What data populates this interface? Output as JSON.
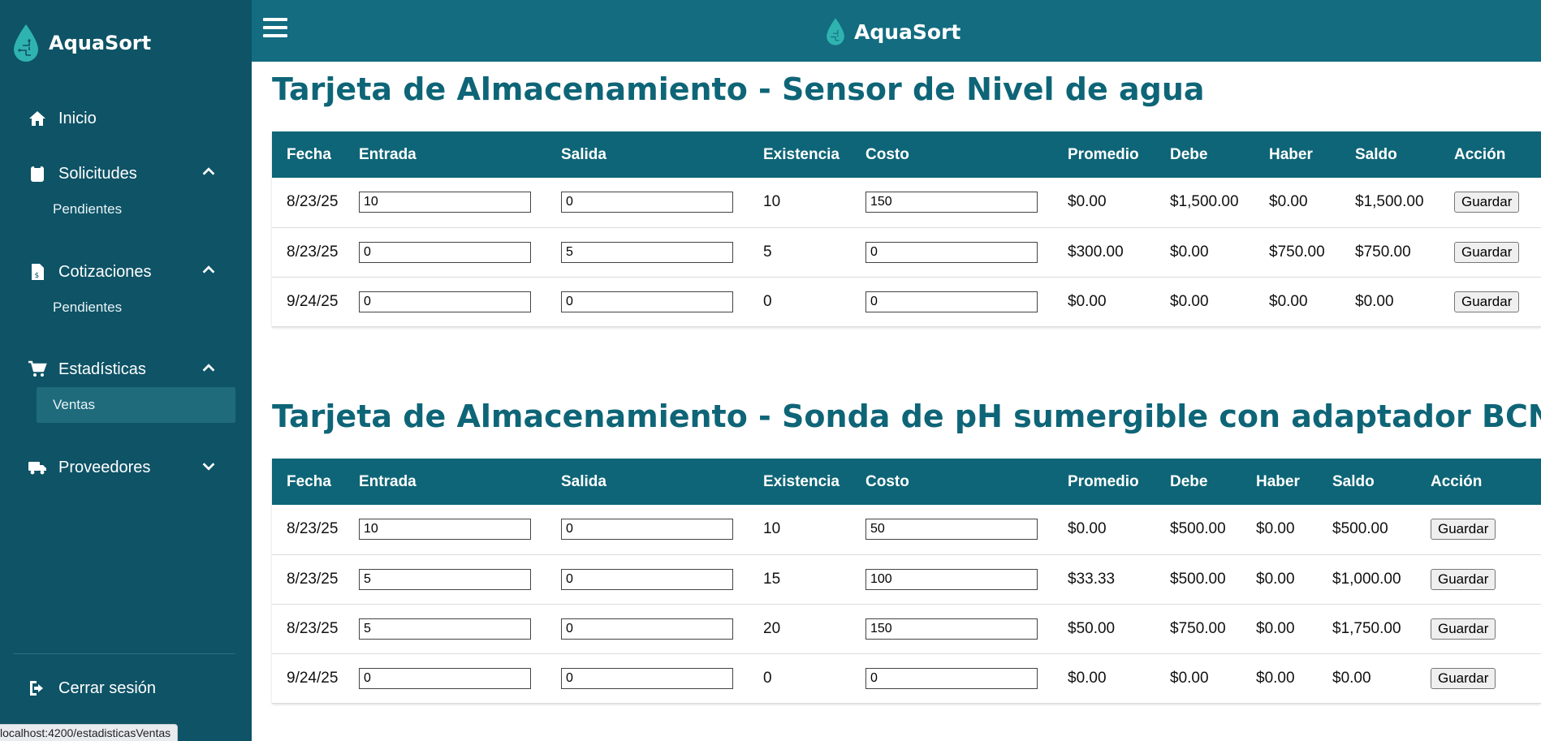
{
  "app": {
    "name": "AquaSort"
  },
  "sidebar": {
    "items": [
      {
        "label": "Inicio",
        "icon": "home-icon"
      },
      {
        "label": "Solicitudes",
        "icon": "clipboard-icon",
        "sub": "Pendientes"
      },
      {
        "label": "Cotizaciones",
        "icon": "invoice-icon",
        "sub": "Pendientes"
      },
      {
        "label": "Estadísticas",
        "icon": "cart-icon",
        "sub": "Ventas"
      },
      {
        "label": "Proveedores",
        "icon": "truck-icon"
      }
    ],
    "logout": "Cerrar sesión"
  },
  "status_url": "localhost:4200/estadisticasVentas",
  "colors": {
    "sidebar": "#0e5366",
    "topbar": "#136c80",
    "table_header": "#0e6577",
    "title": "#0e6577"
  },
  "cards": [
    {
      "title": "Tarjeta de Almacenamiento - Sensor de Nivel de agua",
      "headers": [
        "Fecha",
        "Entrada",
        "Salida",
        "Existencia",
        "Costo",
        "Promedio",
        "Debe",
        "Haber",
        "Saldo",
        "Acción"
      ],
      "rows": [
        {
          "fecha": "8/23/25",
          "entrada": "10",
          "salida": "0",
          "existencia": "10",
          "costo": "150",
          "promedio": "$0.00",
          "debe": "$1,500.00",
          "haber": "$0.00",
          "saldo": "$1,500.00",
          "accion": "Guardar"
        },
        {
          "fecha": "8/23/25",
          "entrada": "0",
          "salida": "5",
          "existencia": "5",
          "costo": "0",
          "promedio": "$300.00",
          "debe": "$0.00",
          "haber": "$750.00",
          "saldo": "$750.00",
          "accion": "Guardar"
        },
        {
          "fecha": "9/24/25",
          "entrada": "0",
          "salida": "0",
          "existencia": "0",
          "costo": "0",
          "promedio": "$0.00",
          "debe": "$0.00",
          "haber": "$0.00",
          "saldo": "$0.00",
          "accion": "Guardar"
        }
      ]
    },
    {
      "title": "Tarjeta de Almacenamiento - Sonda de pH sumergible con adaptador BCN",
      "headers": [
        "Fecha",
        "Entrada",
        "Salida",
        "Existencia",
        "Costo",
        "Promedio",
        "Debe",
        "Haber",
        "Saldo",
        "Acción"
      ],
      "rows": [
        {
          "fecha": "8/23/25",
          "entrada": "10",
          "salida": "0",
          "existencia": "10",
          "costo": "50",
          "promedio": "$0.00",
          "debe": "$500.00",
          "haber": "$0.00",
          "saldo": "$500.00",
          "accion": "Guardar"
        },
        {
          "fecha": "8/23/25",
          "entrada": "5",
          "salida": "0",
          "existencia": "15",
          "costo": "100",
          "promedio": "$33.33",
          "debe": "$500.00",
          "haber": "$0.00",
          "saldo": "$1,000.00",
          "accion": "Guardar"
        },
        {
          "fecha": "8/23/25",
          "entrada": "5",
          "salida": "0",
          "existencia": "20",
          "costo": "150",
          "promedio": "$50.00",
          "debe": "$750.00",
          "haber": "$0.00",
          "saldo": "$1,750.00",
          "accion": "Guardar"
        },
        {
          "fecha": "9/24/25",
          "entrada": "0",
          "salida": "0",
          "existencia": "0",
          "costo": "0",
          "promedio": "$0.00",
          "debe": "$0.00",
          "haber": "$0.00",
          "saldo": "$0.00",
          "accion": "Guardar"
        }
      ]
    }
  ]
}
